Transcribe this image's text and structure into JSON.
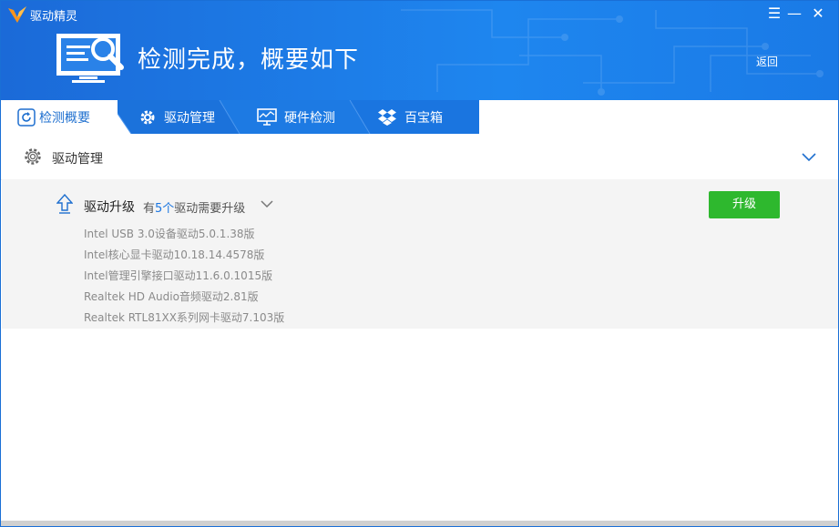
{
  "window": {
    "app_title": "驱动精灵",
    "menu_glyph": "☰",
    "minimize_glyph": "—",
    "close_glyph": "✕"
  },
  "header": {
    "headline": "检测完成，概要如下",
    "back_label": "返回"
  },
  "tabs": [
    {
      "label": "检测概要",
      "icon": "refresh-icon",
      "active": true
    },
    {
      "label": "驱动管理",
      "icon": "gear-icon",
      "active": false
    },
    {
      "label": "硬件检测",
      "icon": "monitor-icon",
      "active": false
    },
    {
      "label": "百宝箱",
      "icon": "dropbox-icon",
      "active": false
    }
  ],
  "section": {
    "title": "驱动管理"
  },
  "upgrade": {
    "title": "驱动升级",
    "count_prefix": "有",
    "count": "5个",
    "count_suffix": "驱动需要升级",
    "button_label": "升级",
    "drivers": [
      "Intel USB 3.0设备驱动5.0.1.38版",
      "Intel核心显卡驱动10.18.14.4578版",
      "Intel管理引擎接口驱动11.6.0.1015版",
      "Realtek HD Audio音频驱动2.81版",
      "Realtek RTL81XX系列网卡驱动7.103版"
    ]
  },
  "colors": {
    "header_blue": "#1a75e0",
    "button_green": "#2eb82e",
    "accent_blue": "#1e6fcf"
  }
}
